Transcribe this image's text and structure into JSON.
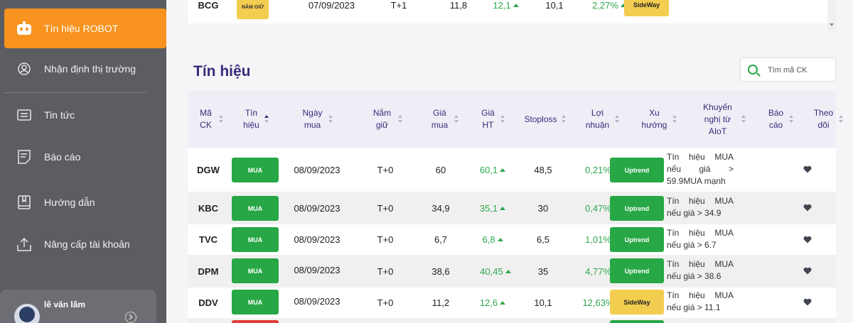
{
  "sidebar": {
    "items": [
      {
        "label": "Tín hiệu ROBOT",
        "icon": "robot-icon"
      },
      {
        "label": "Nhận định thị trường",
        "icon": "user-circle-icon"
      },
      {
        "label": "Tin tức",
        "icon": "news-icon"
      },
      {
        "label": "Báo cáo",
        "icon": "report-icon"
      },
      {
        "label": "Hướng dẫn",
        "icon": "book-icon"
      },
      {
        "label": "Nâng cấp tài khoản",
        "icon": "upload-icon"
      }
    ],
    "user": {
      "name": "lê văn lâm"
    }
  },
  "top_row": {
    "code": "BCG",
    "hold_label": "NẮM GIỮ",
    "date": "07/09/2023",
    "period": "T+1",
    "buy": "11,8",
    "current": "12,1",
    "stoploss": "10,1",
    "profit": "2,27%",
    "trend": "SideWay"
  },
  "page_title": "Tín hiệu",
  "search": {
    "placeholder": "Tìm mã CK"
  },
  "table": {
    "headers": {
      "code": "Mã CK",
      "signal": "Tín hiệu",
      "date": "Ngày mua",
      "hold": "Nắm giữ",
      "buy": "Giá mua",
      "current": "Giá HT",
      "stoploss": "Stoploss",
      "profit": "Lợi nhuận",
      "trend": "Xu hướng",
      "recommend": "Khuyến nghị từ AIoT",
      "report": "Báo cáo",
      "follow": "Theo dõi"
    },
    "rows": [
      {
        "code": "DGW",
        "signal": "MUA",
        "date": "08/09/2023",
        "hold": "T+0",
        "buy": "60",
        "current": "60,1",
        "stoploss": "48,5",
        "profit": "0,21%",
        "trend": "Uptrend",
        "recommend": "Tín hiệu MUA nếu giá > 59.9MUA mạnh"
      },
      {
        "code": "KBC",
        "signal": "MUA",
        "date": "08/09/2023",
        "hold": "T+0",
        "buy": "34,9",
        "current": "35,1",
        "stoploss": "30",
        "profit": "0,47%",
        "trend": "Uptrend",
        "recommend": "Tín hiệu MUA nếu giá > 34.9"
      },
      {
        "code": "TVC",
        "signal": "MUA",
        "date": "08/09/2023",
        "hold": "T+0",
        "buy": "6,7",
        "current": "6,8",
        "stoploss": "6,5",
        "profit": "1,01%",
        "trend": "Uptrend",
        "recommend": "Tín hiệu MUA nếu giá > 6.7"
      },
      {
        "code": "DPM",
        "signal": "MUA",
        "date": "08/09/2023",
        "hold": "T+0",
        "buy": "38,6",
        "current": "40,45",
        "stoploss": "35",
        "profit": "4,77%",
        "trend": "Uptrend",
        "recommend": "Tín hiệu MUA nếu giá > 38.6"
      },
      {
        "code": "DDV",
        "signal": "MUA",
        "date": "08/09/2023",
        "hold": "T+0",
        "buy": "11,2",
        "current": "12,6",
        "stoploss": "10,1",
        "profit": "12,63%",
        "trend": "SideWay",
        "recommend": "Tín hiệu MUA nếu giá > 11.1"
      }
    ]
  },
  "colors": {
    "accent": "#f7931e",
    "sidebar": "#5b5d62",
    "buy": "#27a745",
    "sideway": "#f3cd4f",
    "title": "#3a2a7a"
  }
}
